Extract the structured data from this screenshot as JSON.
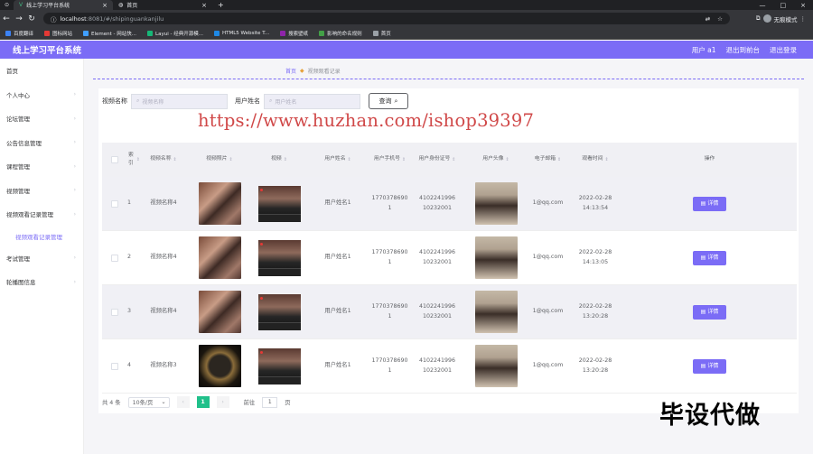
{
  "browser": {
    "tabs": [
      {
        "title": "线上学习平台系统",
        "active": true
      },
      {
        "title": "首页",
        "active": false
      }
    ],
    "url_host": "localhost",
    "url_rest": ":8081/#/shipinguankanjilu",
    "profile_label": "无痕模式",
    "bookmarks": [
      {
        "label": "百度翻译",
        "color": "#3b82f6"
      },
      {
        "label": "图标网站",
        "color": "#e53935"
      },
      {
        "label": "Element - 网站快...",
        "color": "#409eff"
      },
      {
        "label": "Layui - 经典开源模...",
        "color": "#16b777"
      },
      {
        "label": "HTML5 Website T...",
        "color": "#1e88e5"
      },
      {
        "label": "搜索壁纸",
        "color": "#8e24aa"
      },
      {
        "label": "影响的命名规则",
        "color": "#43a047"
      },
      {
        "label": "首页",
        "color": "#9aa0a6"
      }
    ]
  },
  "header": {
    "title": "线上学习平台系统",
    "user_label": "用户 a1",
    "back_label": "退出到前台",
    "logout_label": "退出登录"
  },
  "sidebar": {
    "items": [
      {
        "label": "首页",
        "arrow": false,
        "sub": false
      },
      {
        "label": "个人中心",
        "arrow": true,
        "sub": false
      },
      {
        "label": "论坛管理",
        "arrow": true,
        "sub": false
      },
      {
        "label": "公告信息管理",
        "arrow": true,
        "sub": false
      },
      {
        "label": "课程管理",
        "arrow": true,
        "sub": false
      },
      {
        "label": "视频管理",
        "arrow": true,
        "sub": false
      },
      {
        "label": "视频观看记录管理",
        "arrow": true,
        "sub": false
      },
      {
        "label": "视频观看记录管理",
        "arrow": false,
        "sub": true
      },
      {
        "label": "考试管理",
        "arrow": true,
        "sub": false
      },
      {
        "label": "轮播图信息",
        "arrow": true,
        "sub": false
      }
    ]
  },
  "breadcrumb": {
    "home": "首页",
    "current": "视频观看记录"
  },
  "search": {
    "video_label": "视频名称",
    "video_placeholder": "视频名称",
    "user_label": "用户姓名",
    "user_placeholder": "用户姓名",
    "query_label": "查询"
  },
  "table": {
    "columns": [
      "索引",
      "视频名称",
      "视频照片",
      "视频",
      "用户姓名",
      "用户手机号",
      "用户身份证号",
      "用户头像",
      "电子邮箱",
      "观看时间",
      "操作"
    ],
    "detail_label": "详情",
    "rows": [
      {
        "index": "1",
        "video_name": "视频名称4",
        "photo": "couple",
        "user_name": "用户姓名1",
        "phone": [
          "1770378690",
          "1"
        ],
        "idcard": [
          "4102241996",
          "10232001"
        ],
        "email": "1@qq.com",
        "time": [
          "2022-02-28",
          "14:13:54"
        ]
      },
      {
        "index": "2",
        "video_name": "视频名称4",
        "photo": "couple",
        "user_name": "用户姓名1",
        "phone": [
          "1770378690",
          "1"
        ],
        "idcard": [
          "4102241996",
          "10232001"
        ],
        "email": "1@qq.com",
        "time": [
          "2022-02-28",
          "14:13:05"
        ]
      },
      {
        "index": "3",
        "video_name": "视频名称4",
        "photo": "couple",
        "user_name": "用户姓名1",
        "phone": [
          "1770378690",
          "1"
        ],
        "idcard": [
          "4102241996",
          "10232001"
        ],
        "email": "1@qq.com",
        "time": [
          "2022-02-28",
          "13:20:28"
        ]
      },
      {
        "index": "4",
        "video_name": "视频名称3",
        "photo": "chip",
        "user_name": "用户姓名1",
        "phone": [
          "1770378690",
          "1"
        ],
        "idcard": [
          "4102241996",
          "10232001"
        ],
        "email": "1@qq.com",
        "time": [
          "2022-02-28",
          "13:20:28"
        ]
      }
    ]
  },
  "pager": {
    "total_label": "共 4 条",
    "page_size": "10条/页",
    "current_page": "1",
    "goto_label": "前往",
    "goto_value": "1",
    "page_suffix": "页"
  },
  "overlay": {
    "watermark": "https://www.huzhan.com/ishop39397",
    "promo": "毕设代做"
  }
}
